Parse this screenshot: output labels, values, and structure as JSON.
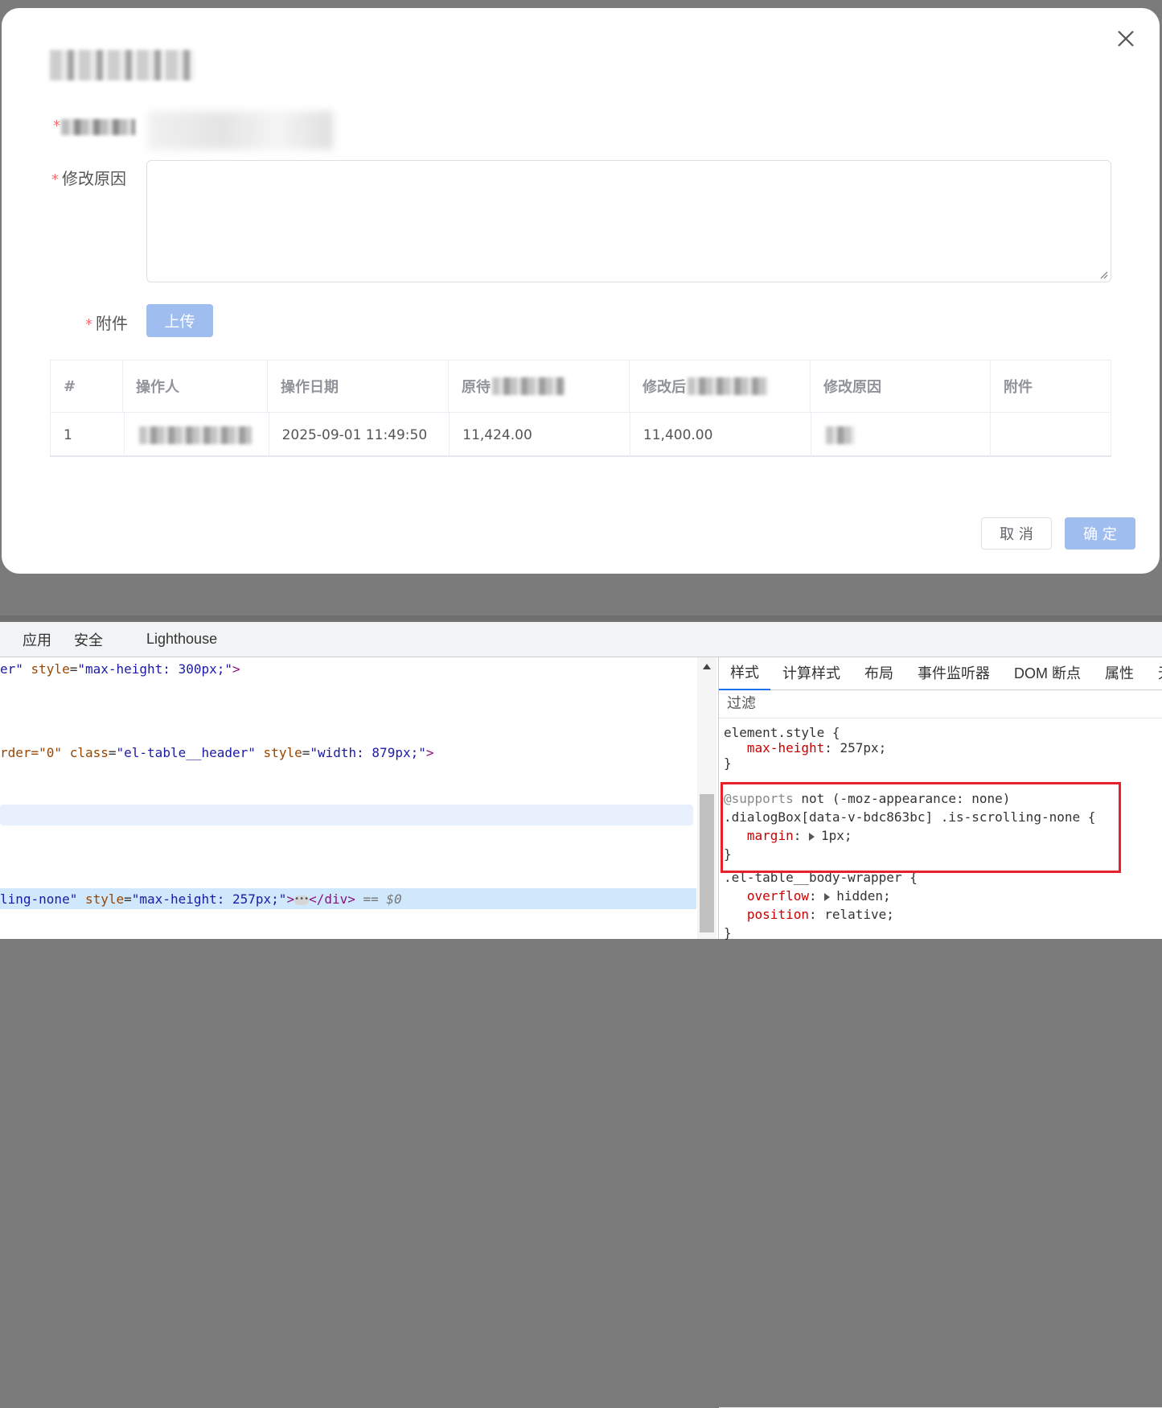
{
  "dialog": {
    "form": {
      "reason_label": "修改原因",
      "attachment_label": "附件",
      "required_mark": "*",
      "upload_label": "上传"
    },
    "table": {
      "headers": [
        "#",
        "操作人",
        "操作日期",
        "原待",
        "修改后",
        "修改原因",
        "附件"
      ],
      "rows": [
        [
          "1",
          "",
          "2025-09-01 11:49:50",
          "11,424.00",
          "11,400.00",
          "",
          ""
        ]
      ]
    },
    "footer": {
      "cancel_label": "取 消",
      "confirm_label": "确 定"
    },
    "colors": {
      "primary_disabled": "#a0bdf0",
      "required": "#f56c6c"
    }
  },
  "devtools": {
    "tabs": [
      "应用",
      "安全",
      "Lighthouse"
    ],
    "elements": {
      "line1": {
        "pre": "er\" ",
        "attr": "style",
        "val": "\"max-height: 300px;\"",
        "post": ">"
      },
      "line2": {
        "pre": "rder=\"0\" ",
        "attr": "class",
        "val": "\"el-table__header\"",
        "attr2": "style",
        "val2": "\"width: 879px;\"",
        "post": ">"
      },
      "line3": {
        "pre": "ling-none\" ",
        "attr": "style",
        "val": "\"max-height: 257px;\"",
        "post": ">",
        "close": "</div>",
        "eq": " == $0"
      }
    },
    "styles": {
      "tabs": [
        "样式",
        "计算样式",
        "布局",
        "事件监听器",
        "DOM 断点",
        "属性",
        "无"
      ],
      "filter_placeholder": "过滤",
      "rule1": {
        "selector": "element.style {",
        "prop": "max-height",
        "value": " 257px;",
        "close": "}"
      },
      "rule2": {
        "at": "@supports",
        "condition": " not (-moz-appearance: none)",
        "selector": ".dialogBox[data-v-bdc863bc] .is-scrolling-none {",
        "prop": "margin",
        "value": "1px;",
        "close": "}"
      },
      "rule3": {
        "selector": ".el-table__body-wrapper {",
        "prop1": "overflow",
        "value1": "hidden;",
        "prop2": "position",
        "value2": " relative;",
        "close": "}"
      }
    }
  }
}
